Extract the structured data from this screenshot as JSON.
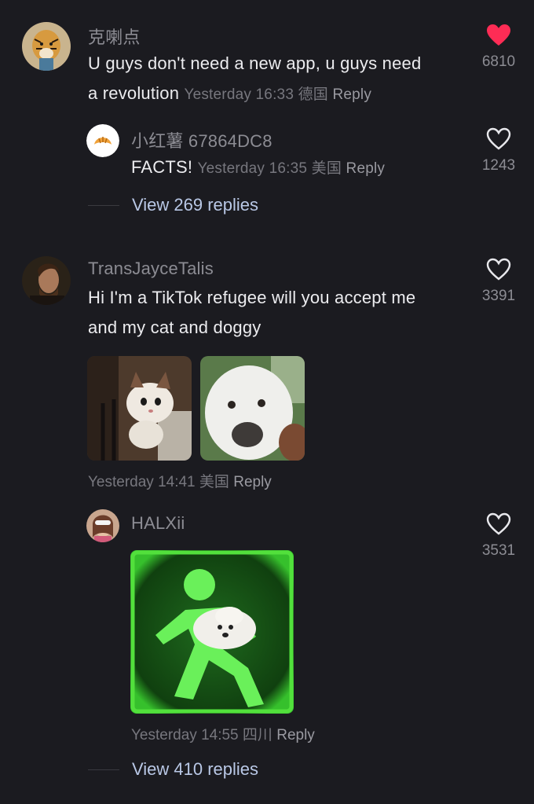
{
  "comments": [
    {
      "username": "克喇点",
      "text_line1": "U guys don't need a new app, u guys need",
      "text_line2": "a revolution",
      "time": "Yesterday 16:33",
      "location": "德国",
      "reply_label": "Reply",
      "likes": "6810",
      "liked": true,
      "avatar_icon": "tiger-avatar-icon",
      "replies": [
        {
          "username": "小红薯 67864DC8",
          "text": "FACTS!",
          "time": "Yesterday 16:35",
          "location": "美国",
          "reply_label": "Reply",
          "likes": "1243",
          "avatar_icon": "croissant-avatar-icon"
        }
      ],
      "view_replies": "View 269 replies"
    },
    {
      "username": "TransJayceTalis",
      "text_line1": "Hi I'm a TikTok refugee will you accept me",
      "text_line2": "and my cat and doggy",
      "time": "Yesterday 14:41",
      "location": "美国",
      "reply_label": "Reply",
      "likes": "3391",
      "liked": false,
      "avatar_icon": "man-portrait-avatar-icon",
      "images": [
        "cat-photo",
        "dog-photo"
      ],
      "replies": [
        {
          "username": "HALXii",
          "time": "Yesterday 14:55",
          "location": "四川",
          "reply_label": "Reply",
          "likes": "3531",
          "avatar_icon": "girl-avatar-icon",
          "image": "running-dog-exit-sign-image"
        }
      ],
      "view_replies": "View 410 replies"
    }
  ],
  "colors": {
    "background": "#1b1b20",
    "liked_heart": "#fe2c55",
    "link": "#b9c8e6"
  }
}
